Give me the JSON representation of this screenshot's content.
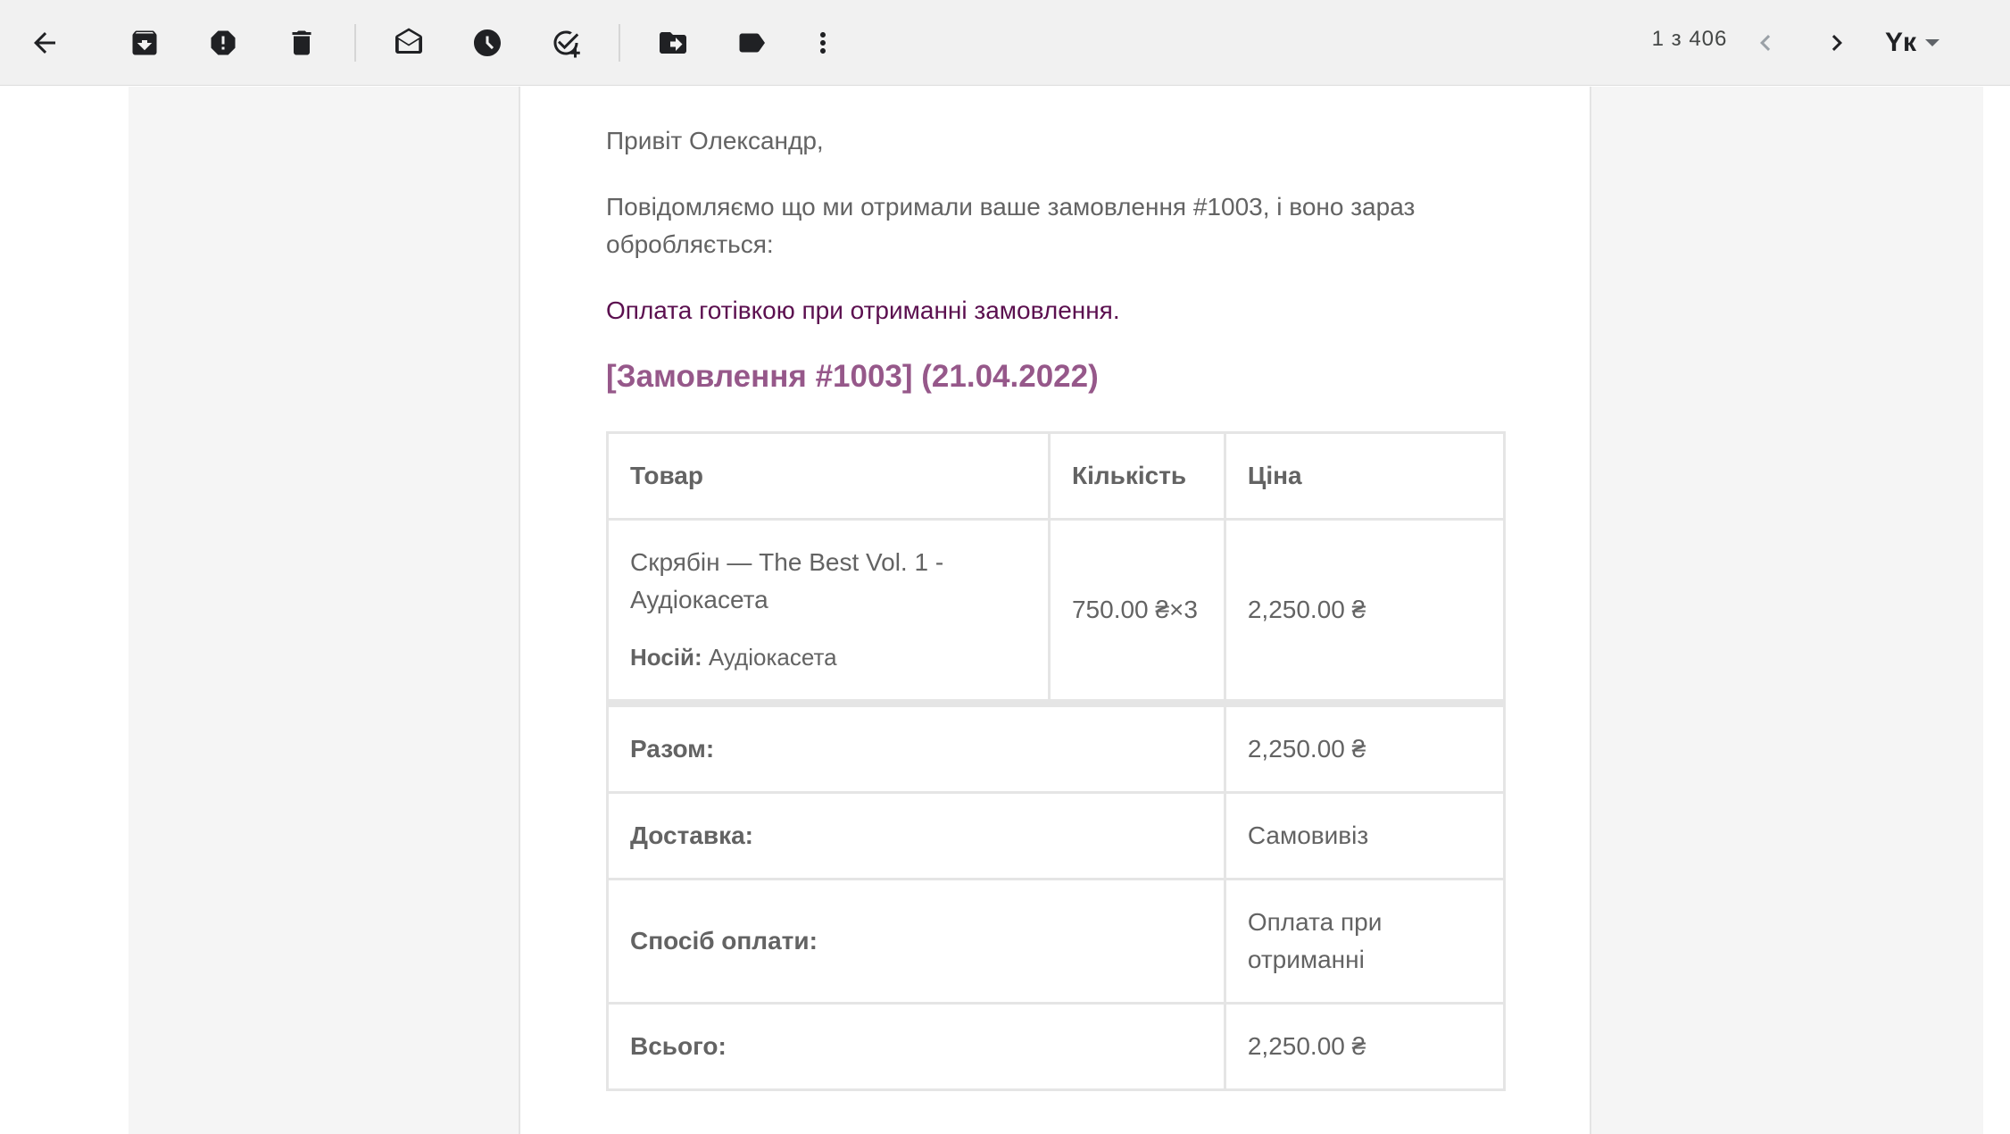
{
  "toolbar": {
    "icons": [
      "back-arrow-icon",
      "archive-icon",
      "report-spam-icon",
      "delete-icon",
      "mark-unread-icon",
      "snooze-icon",
      "add-task-icon",
      "move-to-icon",
      "label-icon",
      "more-vert-icon"
    ],
    "pager": "1 з 406",
    "language_label": "Yк"
  },
  "email": {
    "greeting": "Привіт Олександр,",
    "notice": "Повідомляємо що ми отримали ваше замовлення #1003, і воно зараз обробляється:",
    "payment_note": "Оплата готівкою при отриманні замовлення.",
    "order_heading": "[Замовлення #1003] (21.04.2022)",
    "table": {
      "headers": [
        "Товар",
        "Кількість",
        "Ціна"
      ],
      "items": [
        {
          "name": "Скрябін — The Best Vol. 1 - Аудіокасета",
          "meta_label": "Носій:",
          "meta_value": "Аудіокасета",
          "quantity": "750.00 ₴×3",
          "price": "2,250.00 ₴"
        }
      ],
      "totals": [
        {
          "label": "Разом:",
          "value": "2,250.00 ₴"
        },
        {
          "label": "Доставка:",
          "value": "Самовивіз"
        },
        {
          "label": "Спосіб оплати:",
          "value": "Оплата при отриманні"
        },
        {
          "label": "Всього:",
          "value": "2,250.00 ₴"
        }
      ]
    }
  },
  "colors": {
    "toolbar_bg": "#f1f1f1",
    "heading": "#96588a",
    "payment_note": "#5b0f4f",
    "body_text": "#636363",
    "table_border": "#e5e5e5"
  }
}
